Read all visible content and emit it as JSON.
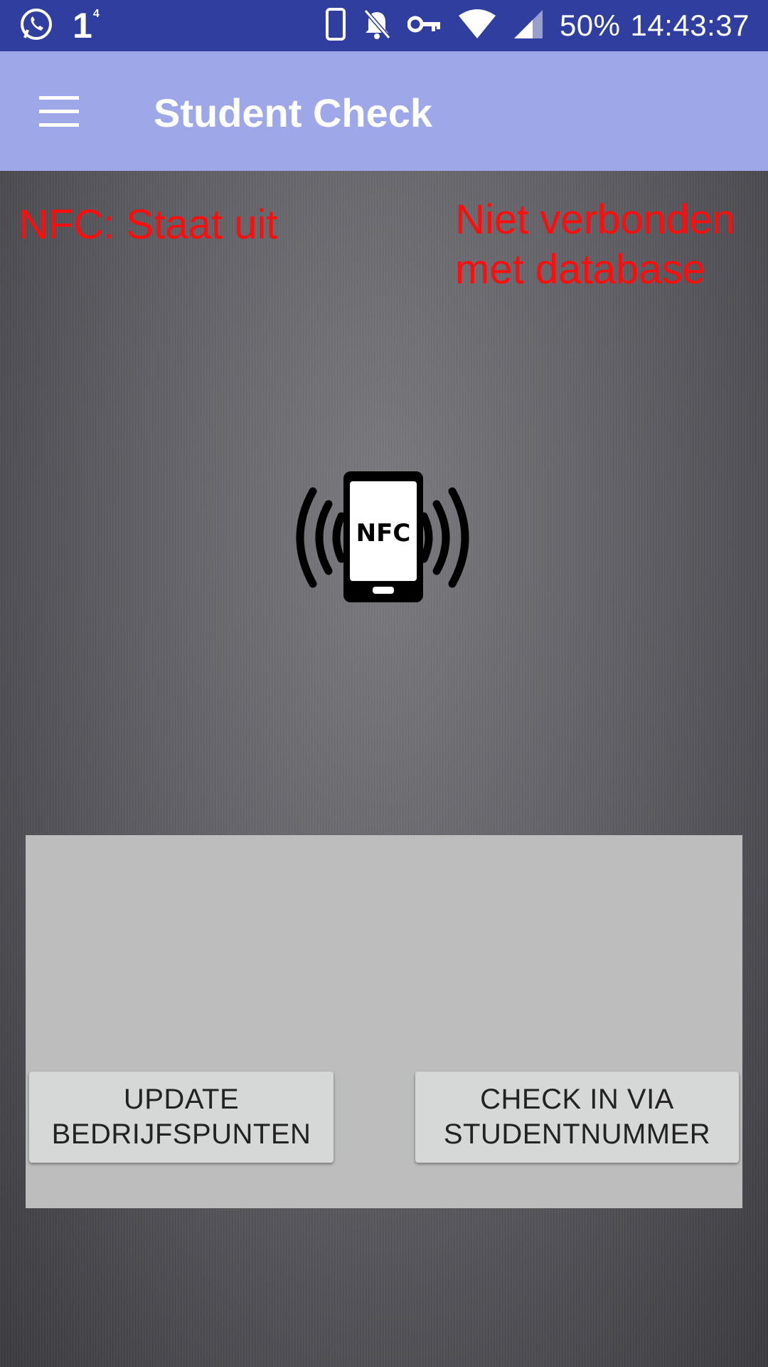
{
  "status_bar": {
    "notification_count": "1",
    "notification_sup": "4",
    "battery": "50%",
    "time": "14:43:37",
    "icons": [
      "whatsapp-icon",
      "phone-icon",
      "bell-off-icon",
      "key-icon",
      "wifi-icon",
      "signal-icon"
    ]
  },
  "app_bar": {
    "title": "Student Check",
    "menu_icon": "hamburger-menu-icon"
  },
  "main": {
    "nfc_status": "NFC: Staat uit",
    "db_status_line1": "Niet verbonden",
    "db_status_line2": "met database",
    "nfc_icon_label": "NFC"
  },
  "buttons": {
    "update_line1": "UPDATE",
    "update_line2": "BEDRIJFSPUNTEN",
    "checkin_line1": "CHECK IN VIA",
    "checkin_line2": "STUDENTNUMMER"
  },
  "colors": {
    "status_bar": "#303f9f",
    "app_bar": "#9ea8e8",
    "status_text": "#ff0c0c",
    "panel": "#bdbdbd",
    "button": "#d6d7d7"
  }
}
